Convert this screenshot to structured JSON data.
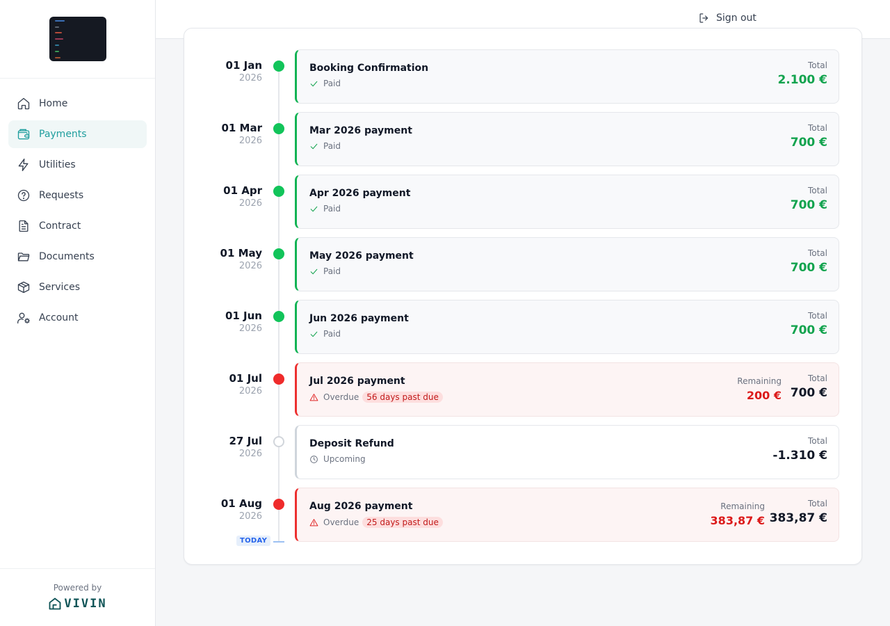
{
  "sidebar": {
    "items": [
      {
        "label": "Home",
        "icon": "home-icon"
      },
      {
        "label": "Payments",
        "icon": "wallet-icon",
        "active": true
      },
      {
        "label": "Utilities",
        "icon": "zap-icon"
      },
      {
        "label": "Requests",
        "icon": "help-circle-icon"
      },
      {
        "label": "Contract",
        "icon": "file-text-icon"
      },
      {
        "label": "Documents",
        "icon": "folder-icon"
      },
      {
        "label": "Services",
        "icon": "box-icon"
      },
      {
        "label": "Account",
        "icon": "user-cog-icon"
      }
    ],
    "powered_by": "Powered by",
    "brand": "VIVIN"
  },
  "header": {
    "sign_out": "Sign out"
  },
  "colors": {
    "accent": "#1f9e9e",
    "paid": "#12b354",
    "overdue": "#ec2f2f",
    "today": "#2563eb"
  },
  "timeline": {
    "today_label": "TODAY",
    "entries": [
      {
        "day": "01 Jan",
        "year": "2026",
        "title": "Booking Confirmation",
        "status": "Paid",
        "state": "paid",
        "total_label": "Total",
        "total": "2.100 €"
      },
      {
        "day": "01 Mar",
        "year": "2026",
        "title": "Mar 2026 payment",
        "status": "Paid",
        "state": "paid",
        "total_label": "Total",
        "total": "700 €"
      },
      {
        "day": "01 Apr",
        "year": "2026",
        "title": "Apr 2026 payment",
        "status": "Paid",
        "state": "paid",
        "total_label": "Total",
        "total": "700 €"
      },
      {
        "day": "01 May",
        "year": "2026",
        "title": "May 2026 payment",
        "status": "Paid",
        "state": "paid",
        "total_label": "Total",
        "total": "700 €"
      },
      {
        "day": "01 Jun",
        "year": "2026",
        "title": "Jun 2026 payment",
        "status": "Paid",
        "state": "paid",
        "total_label": "Total",
        "total": "700 €"
      },
      {
        "day": "01 Jul",
        "year": "2026",
        "title": "Jul 2026 payment",
        "status": "Overdue",
        "past_due": "56 days past due",
        "state": "overdue",
        "remaining_label": "Remaining",
        "remaining": "200 €",
        "total_label": "Total",
        "total": "700 €"
      },
      {
        "day": "27 Jul",
        "year": "2026",
        "title": "Deposit Refund",
        "status": "Upcoming",
        "state": "upcoming",
        "total_label": "Total",
        "total": "-1.310 €"
      },
      {
        "day": "01 Aug",
        "year": "2026",
        "title": "Aug 2026 payment",
        "status": "Overdue",
        "past_due": "25 days past due",
        "state": "overdue",
        "remaining_label": "Remaining",
        "remaining": "383,87 €",
        "total_label": "Total",
        "total": "383,87 €"
      }
    ]
  }
}
